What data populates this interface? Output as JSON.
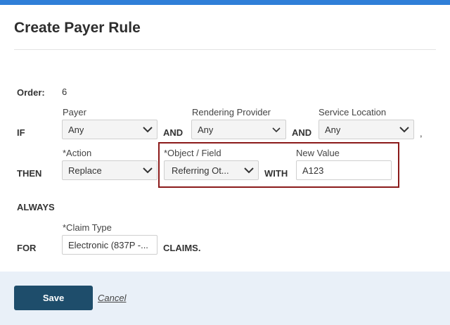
{
  "modal": {
    "title": "Create Payer Rule"
  },
  "order": {
    "label": "Order:",
    "value": "6"
  },
  "if_row": {
    "keyword": "IF",
    "payer": {
      "label": "Payer",
      "value": "Any"
    },
    "and1": "AND",
    "rendering_provider": {
      "label": "Rendering Provider",
      "value": "Any"
    },
    "and2": "AND",
    "service_location": {
      "label": "Service Location",
      "value": "Any"
    },
    "trailing": ","
  },
  "then_row": {
    "keyword": "THEN",
    "action": {
      "label": "*Action",
      "value": "Replace"
    },
    "object_field": {
      "label": "*Object / Field",
      "value": "Referring Ot..."
    },
    "with": "WITH",
    "new_value": {
      "label": "New Value",
      "value": "A123"
    }
  },
  "always": "ALWAYS",
  "for_row": {
    "keyword": "FOR",
    "claim_type": {
      "label": "*Claim Type",
      "value": "Electronic (837P -..."
    },
    "suffix": "CLAIMS."
  },
  "footer": {
    "save_label": "Save",
    "cancel_label": "Cancel"
  },
  "colors": {
    "accent_bar": "#2f7fd8",
    "save_button": "#1e4d6b",
    "highlight_border": "#8b1a1a",
    "footer_bg": "#e9f0f8"
  }
}
